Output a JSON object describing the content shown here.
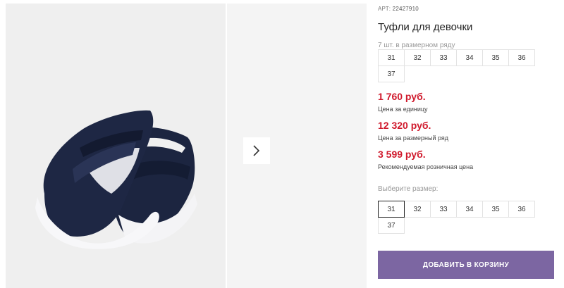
{
  "product": {
    "article_label": "АРТ:",
    "article_number": "22427910",
    "title": "Туфли для девочки",
    "image_alt": "shoe-photo"
  },
  "size_row": {
    "note": "7 шт. в размерном ряду",
    "sizes": [
      "31",
      "32",
      "33",
      "34",
      "35",
      "36",
      "37"
    ]
  },
  "prices": {
    "unit_price": "1 760 руб.",
    "unit_label": "Цена за единицу",
    "row_price": "12 320 руб.",
    "row_label": "Цена за размерный ряд",
    "retail_price": "3 599 руб.",
    "retail_label": "Рекомендуемая розничная цена"
  },
  "size_select": {
    "label": "Выберите размер:",
    "sizes": [
      "31",
      "32",
      "33",
      "34",
      "35",
      "36",
      "37"
    ],
    "selected": "31"
  },
  "actions": {
    "add_to_cart": "ДОБАВИТЬ В КОРЗИНУ"
  },
  "colors": {
    "price_red": "#d0192c",
    "button_purple": "#7c66a2"
  },
  "icons": {
    "next": "chevron-right-icon"
  }
}
